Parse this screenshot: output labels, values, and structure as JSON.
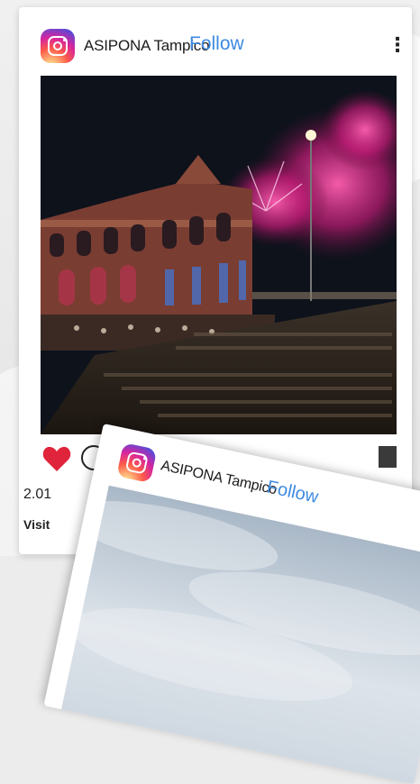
{
  "post": {
    "account": "ASIPONA Tampico",
    "follow_label": "Follow",
    "more_label": "⋮",
    "likes_partial": "2.01",
    "caption_partial": "Visit"
  },
  "second_post": {
    "account": "ASIPONA Tampico",
    "follow_label": "Follow"
  },
  "colors": {
    "follow": "#3d8ae0",
    "heart": "#e0243c",
    "fireworks": "#d6247f"
  },
  "icons": [
    "instagram-logo-icon",
    "more-vertical-icon",
    "heart-icon",
    "comment-icon",
    "bookmark-icon"
  ]
}
